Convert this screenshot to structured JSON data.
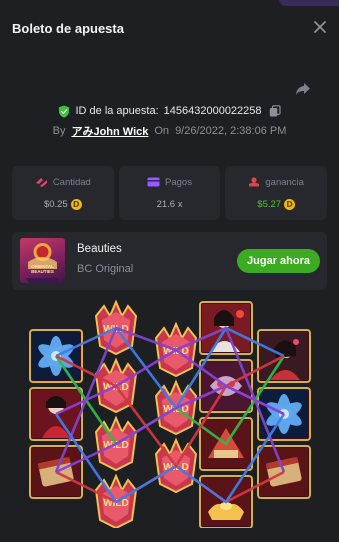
{
  "header": {
    "title": "Boleto de apuesta"
  },
  "bet": {
    "id_label": "ID de la apuesta:",
    "id_value": "1456432000022258",
    "by_label": "By",
    "user": "アみJohn Wick",
    "on_label": "On",
    "datetime": "9/26/2022, 2:38:06 PM"
  },
  "stats": {
    "amount": {
      "label": "Cantidad",
      "value": "$0.25",
      "icon": "bet-stack-icon",
      "color": "#e0457a"
    },
    "payout": {
      "label": "Pagos",
      "value": "21.6 x",
      "icon": "wallet-icon",
      "color": "#9b59ff"
    },
    "profit": {
      "label": "ganancia",
      "value": "$5.27",
      "icon": "profit-coins-icon",
      "color": "#e04545",
      "value_color": "#4fc32c"
    },
    "coin_symbol": "D"
  },
  "game": {
    "name": "Beauties",
    "provider": "BC Original",
    "thumb_text": "ORIENTAL BEAUTIES",
    "play_label": "Jugar ahora",
    "play_color": "#3dab22"
  },
  "reels": {
    "columns": [
      [
        "blue-lotus",
        "beauty-red-dress",
        "scroll-chest"
      ],
      [
        "wild",
        "wild",
        "wild",
        "wild"
      ],
      [
        "wild",
        "wild",
        "wild"
      ],
      [
        "beauty-lantern",
        "dragon-mask",
        "fan-scroll",
        "gold-ingots"
      ],
      [
        "beauty-hairpin",
        "blue-lotus",
        "scroll-chest"
      ]
    ],
    "wild_text": "WILD",
    "line_colors": [
      "#3f7be8",
      "#d2373f",
      "#8a3fd6",
      "#2fb84a",
      "#7f44c9"
    ]
  }
}
